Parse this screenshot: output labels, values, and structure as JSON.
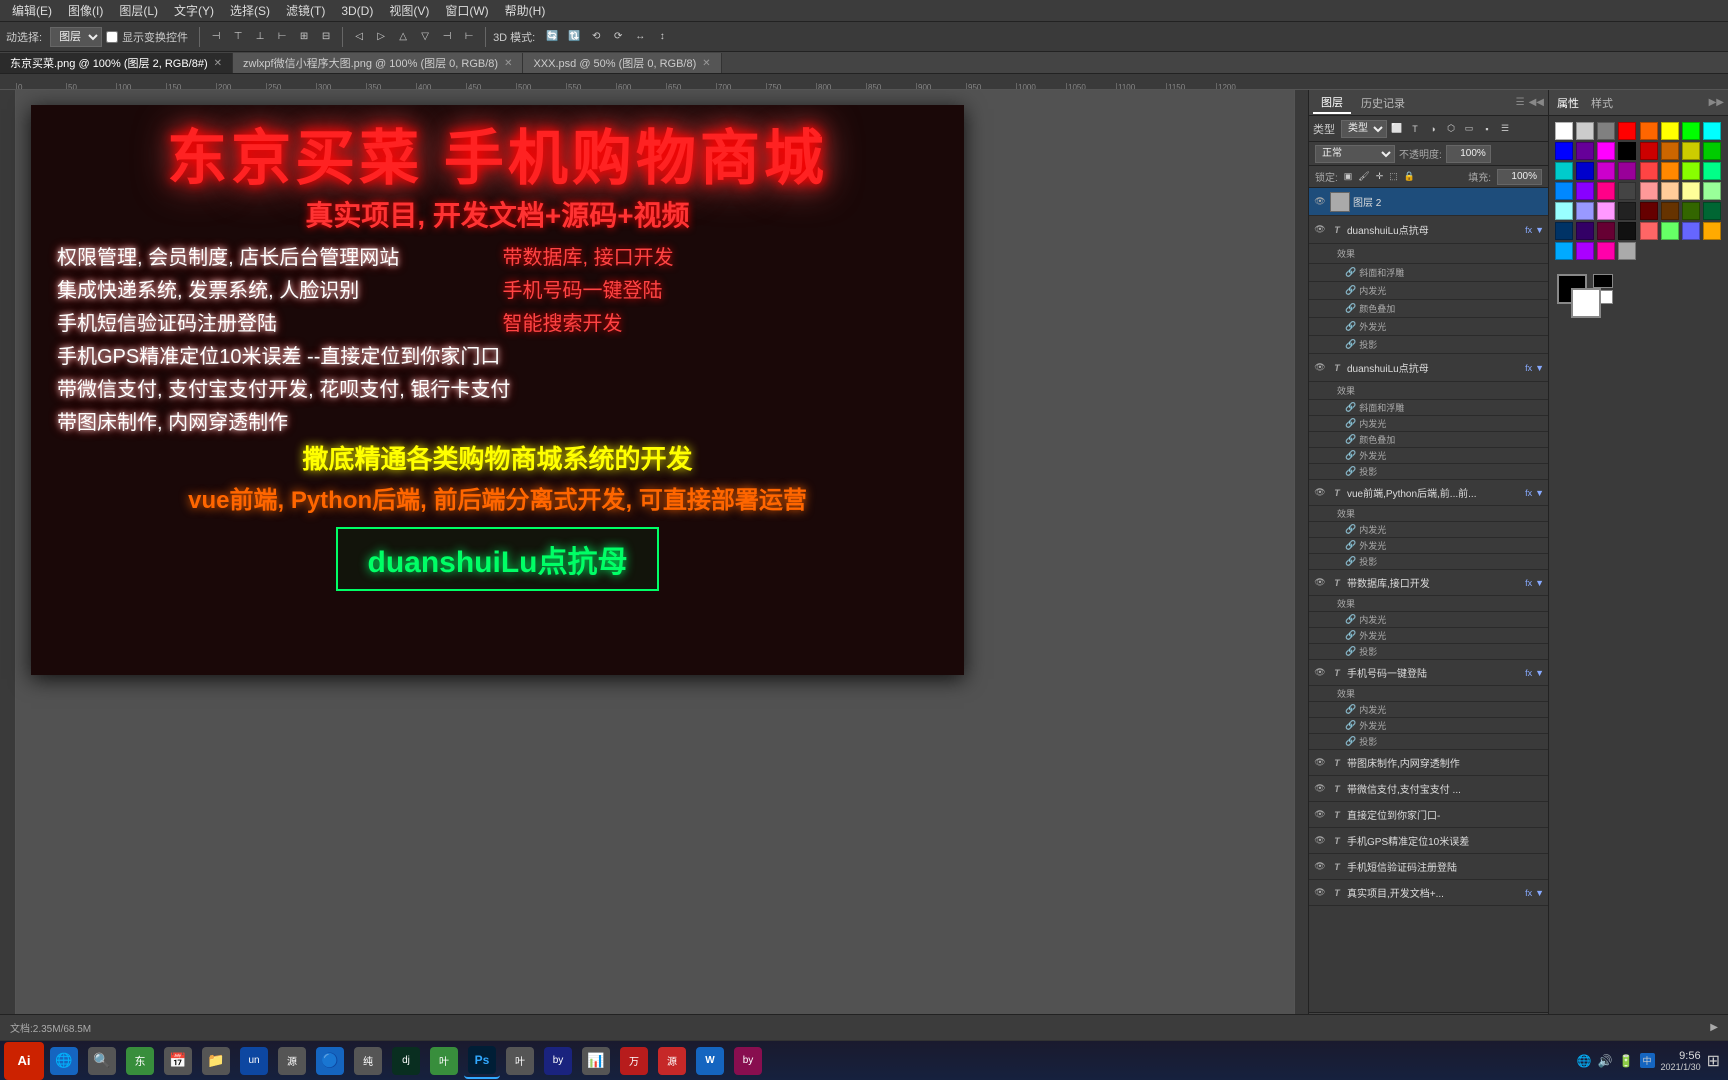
{
  "app": {
    "title": "Adobe Photoshop"
  },
  "menu": {
    "items": [
      "编辑(E)",
      "图像(I)",
      "图层(L)",
      "文字(Y)",
      "选择(S)",
      "滤镜(T)",
      "3D(D)",
      "视图(V)",
      "窗口(W)",
      "帮助(H)"
    ]
  },
  "toolbar": {
    "move_label": "动选择:",
    "mode": "图层",
    "show_controls": "显示变换控件",
    "mode_3d": "3D 模式:",
    "align_icons": [
      "⊣",
      "⊢",
      "⊤",
      "⊥",
      "⊞",
      "⊟",
      "◁",
      "▷",
      "△",
      "▽"
    ]
  },
  "tabs": [
    {
      "label": "东京买菜.png @ 100% (图层 2, RGB/8#)",
      "active": true,
      "closeable": true
    },
    {
      "label": "zwlxpf微信小程序大图.png @ 100% (图层 0, RGB/8)",
      "active": false,
      "closeable": true
    },
    {
      "label": "XXX.psd @ 50% (图层 0, RGB/8)",
      "active": false,
      "closeable": true
    }
  ],
  "canvas": {
    "title_main": "东京买菜    手机购物商城",
    "title_sub": "真实项目, 开发文档+源码+视频",
    "lines": [
      {
        "text": "权限管理, 会员制度, 店长后台管理网站",
        "col": 1,
        "style": "white"
      },
      {
        "text": "带数据库, 接口开发",
        "col": 2,
        "style": "red"
      },
      {
        "text": "集成快递系统, 发票系统, 人脸识别",
        "col": 1,
        "style": "white"
      },
      {
        "text": "手机号码一键登陆",
        "col": 2,
        "style": "red"
      },
      {
        "text": "手机短信验证码注册登陆",
        "col": 1,
        "style": "white"
      },
      {
        "text": "智能搜索开发",
        "col": 2,
        "style": "red"
      },
      {
        "text": "手机GPS精准定位10米误差 --直接定位到你家门口",
        "col": "full",
        "style": "white"
      },
      {
        "text": "带微信支付, 支付宝支付开发, 花呗支付, 银行卡支付",
        "col": "full",
        "style": "white"
      },
      {
        "text": "带图床制作, 内网穿透制作",
        "col": "full",
        "style": "white"
      },
      {
        "text": "撒底精通各类购物商城系统的开发",
        "col": "highlight",
        "style": "yellow"
      },
      {
        "text": "vue前端, Python后端, 前后端分离式开发, 可直接部署运营",
        "col": "highlight2",
        "style": "orange"
      }
    ],
    "cta": "duanshuiLu点抗母"
  },
  "layers_panel": {
    "tabs": [
      "图层",
      "历史记录"
    ],
    "kind_label": "类型",
    "blend_mode": "正常",
    "opacity": "100%",
    "lock_label": "锁定:",
    "fill_label": "填充:",
    "fill_value": "100%",
    "layers": [
      {
        "id": "layer2",
        "name": "图层 2",
        "type": "image",
        "visible": true,
        "selected": true,
        "thumb_color": "#888"
      },
      {
        "id": "dsl1",
        "name": "duanshuiLu点抗母",
        "type": "text",
        "visible": true,
        "has_fx": true,
        "fx_label": "fx"
      },
      {
        "id": "dsl1-effects",
        "name": "效果",
        "type": "group",
        "indent": true
      },
      {
        "id": "dsl1-bevel",
        "name": "斜面和浮雕",
        "type": "effect",
        "indent": true,
        "linked": true
      },
      {
        "id": "dsl1-inner",
        "name": "内发光",
        "type": "effect",
        "indent": true,
        "linked": true
      },
      {
        "id": "dsl1-color",
        "name": "颜色叠加",
        "type": "effect",
        "indent": true,
        "linked": true
      },
      {
        "id": "dsl1-outer",
        "name": "外发光",
        "type": "effect",
        "indent": true,
        "linked": true
      },
      {
        "id": "dsl1-shadow",
        "name": "投影",
        "type": "effect",
        "indent": true,
        "linked": true
      },
      {
        "id": "dsl2",
        "name": "duanshuiLu点抗母",
        "type": "text",
        "visible": true,
        "has_fx": true,
        "fx_label": "fx"
      },
      {
        "id": "dsl2-effects",
        "name": "效果",
        "type": "group",
        "indent": true
      },
      {
        "id": "dsl2-bevel",
        "name": "斜面和浮雕",
        "type": "effect",
        "indent": true,
        "linked": true
      },
      {
        "id": "dsl2-inner",
        "name": "内发光",
        "type": "effect",
        "indent": true,
        "linked": true
      },
      {
        "id": "dsl2-color",
        "name": "颜色叠加",
        "type": "effect",
        "indent": true,
        "linked": true
      },
      {
        "id": "dsl2-outer",
        "name": "外发光",
        "type": "effect",
        "indent": true,
        "linked": true
      },
      {
        "id": "dsl2-shadow",
        "name": "投影",
        "type": "effect",
        "indent": true,
        "linked": true
      },
      {
        "id": "vue-layer",
        "name": "vue前端,Python后端,前...前...",
        "type": "text",
        "visible": true,
        "has_fx": true,
        "fx_label": "fx"
      },
      {
        "id": "vue-effects",
        "name": "效果",
        "type": "group",
        "indent": true
      },
      {
        "id": "vue-inner",
        "name": "内发光",
        "type": "effect",
        "indent": true,
        "linked": true
      },
      {
        "id": "vue-outer",
        "name": "外发光",
        "type": "effect",
        "indent": true,
        "linked": true
      },
      {
        "id": "vue-shadow",
        "name": "投影",
        "type": "effect",
        "indent": true,
        "linked": true
      },
      {
        "id": "db-layer",
        "name": "带数据库,接口开发",
        "type": "text",
        "visible": true,
        "has_fx": true,
        "fx_label": "fx"
      },
      {
        "id": "db-effects",
        "name": "效果",
        "type": "group",
        "indent": true
      },
      {
        "id": "db-inner",
        "name": "内发光",
        "type": "effect",
        "indent": true,
        "linked": true
      },
      {
        "id": "db-outer",
        "name": "外发光",
        "type": "effect",
        "indent": true,
        "linked": true
      },
      {
        "id": "db-shadow",
        "name": "投影",
        "type": "effect",
        "indent": true,
        "linked": true
      },
      {
        "id": "phone-layer",
        "name": "手机号码一键登陆",
        "type": "text",
        "visible": true,
        "has_fx": true,
        "fx_label": "fx"
      },
      {
        "id": "phone-effects",
        "name": "效果",
        "type": "group",
        "indent": true
      },
      {
        "id": "phone-inner",
        "name": "内发光",
        "type": "effect",
        "indent": true,
        "linked": true
      },
      {
        "id": "phone-outer",
        "name": "外发光",
        "type": "effect",
        "indent": true,
        "linked": true
      },
      {
        "id": "phone-shadow",
        "name": "投影",
        "type": "effect",
        "indent": true,
        "linked": true
      },
      {
        "id": "imgbed-layer",
        "name": "带图床制作,内网穿透制作",
        "type": "text",
        "visible": true
      },
      {
        "id": "wechat-layer",
        "name": "带微信支付,支付宝支付 ...",
        "type": "text",
        "visible": true
      },
      {
        "id": "gps-layer",
        "name": "直接定位到你家门口-",
        "type": "text",
        "visible": true
      },
      {
        "id": "gps2-layer",
        "name": "手机GPS精准定位10米误差",
        "type": "text",
        "visible": true
      },
      {
        "id": "sms-layer",
        "name": "手机短信验证码注册登陆",
        "type": "text",
        "visible": true
      },
      {
        "id": "real-layer",
        "name": "真实项目,开发文档+...",
        "type": "text",
        "visible": true,
        "has_fx": true,
        "fx_label": "fx"
      }
    ]
  },
  "color_panel": {
    "swatches": [
      "#ff0000",
      "#ff6600",
      "#ffff00",
      "#00ff00",
      "#00ffff",
      "#0000ff",
      "#ff00ff",
      "#ffffff",
      "#cc0000",
      "#cc6600",
      "#cccc00",
      "#00cc00",
      "#00cccc",
      "#0000cc",
      "#cc00cc",
      "#cccccc",
      "#990000",
      "#996600",
      "#999900",
      "#009900",
      "#009999",
      "#000099",
      "#990099",
      "#999999",
      "#660000",
      "#663300",
      "#666600",
      "#006600",
      "#006666",
      "#000066",
      "#660066",
      "#666666",
      "#330000",
      "#331100",
      "#333300",
      "#003300",
      "#003333",
      "#000033",
      "#330033",
      "#333333",
      "#000000",
      "#111111",
      "#222222",
      "#444444",
      "#555555",
      "#777777",
      "#888888",
      "#aaaaaa"
    ]
  },
  "status_bar": {
    "text": "文档:2.35M/68.5M"
  },
  "taskbar": {
    "start_icon": "Ai",
    "time": "9:56",
    "date": "2021/1/30",
    "icons": [
      {
        "name": "browser",
        "bg": "#1565C0",
        "label": "🌐"
      },
      {
        "name": "search",
        "bg": "#555",
        "label": "🔍"
      },
      {
        "name": "app1",
        "bg": "#2e7d32",
        "label": "东"
      },
      {
        "name": "app2",
        "bg": "#555",
        "label": "📅"
      },
      {
        "name": "file",
        "bg": "#555",
        "label": "📁"
      },
      {
        "name": "app3",
        "bg": "#0d47a1",
        "label": "un"
      },
      {
        "name": "app4",
        "bg": "#555",
        "label": "源"
      },
      {
        "name": "app5",
        "bg": "#555",
        "label": "🔵"
      },
      {
        "name": "app6",
        "bg": "#555",
        "label": "纯"
      },
      {
        "name": "app7",
        "bg": "#555",
        "label": "dj"
      },
      {
        "name": "app8",
        "bg": "#555",
        "label": "叶"
      },
      {
        "name": "ps",
        "bg": "#001e36",
        "label": "Ps"
      },
      {
        "name": "app9",
        "bg": "#555",
        "label": "叶"
      },
      {
        "name": "app10",
        "bg": "#1a237e",
        "label": "by"
      },
      {
        "name": "app11",
        "bg": "#555",
        "label": "📊"
      },
      {
        "name": "app12",
        "bg": "#555",
        "label": "万"
      },
      {
        "name": "app13",
        "bg": "#c62828",
        "label": "源"
      },
      {
        "name": "app14",
        "bg": "#555",
        "label": "W"
      },
      {
        "name": "app15",
        "bg": "#880E4F",
        "label": "by"
      }
    ]
  }
}
